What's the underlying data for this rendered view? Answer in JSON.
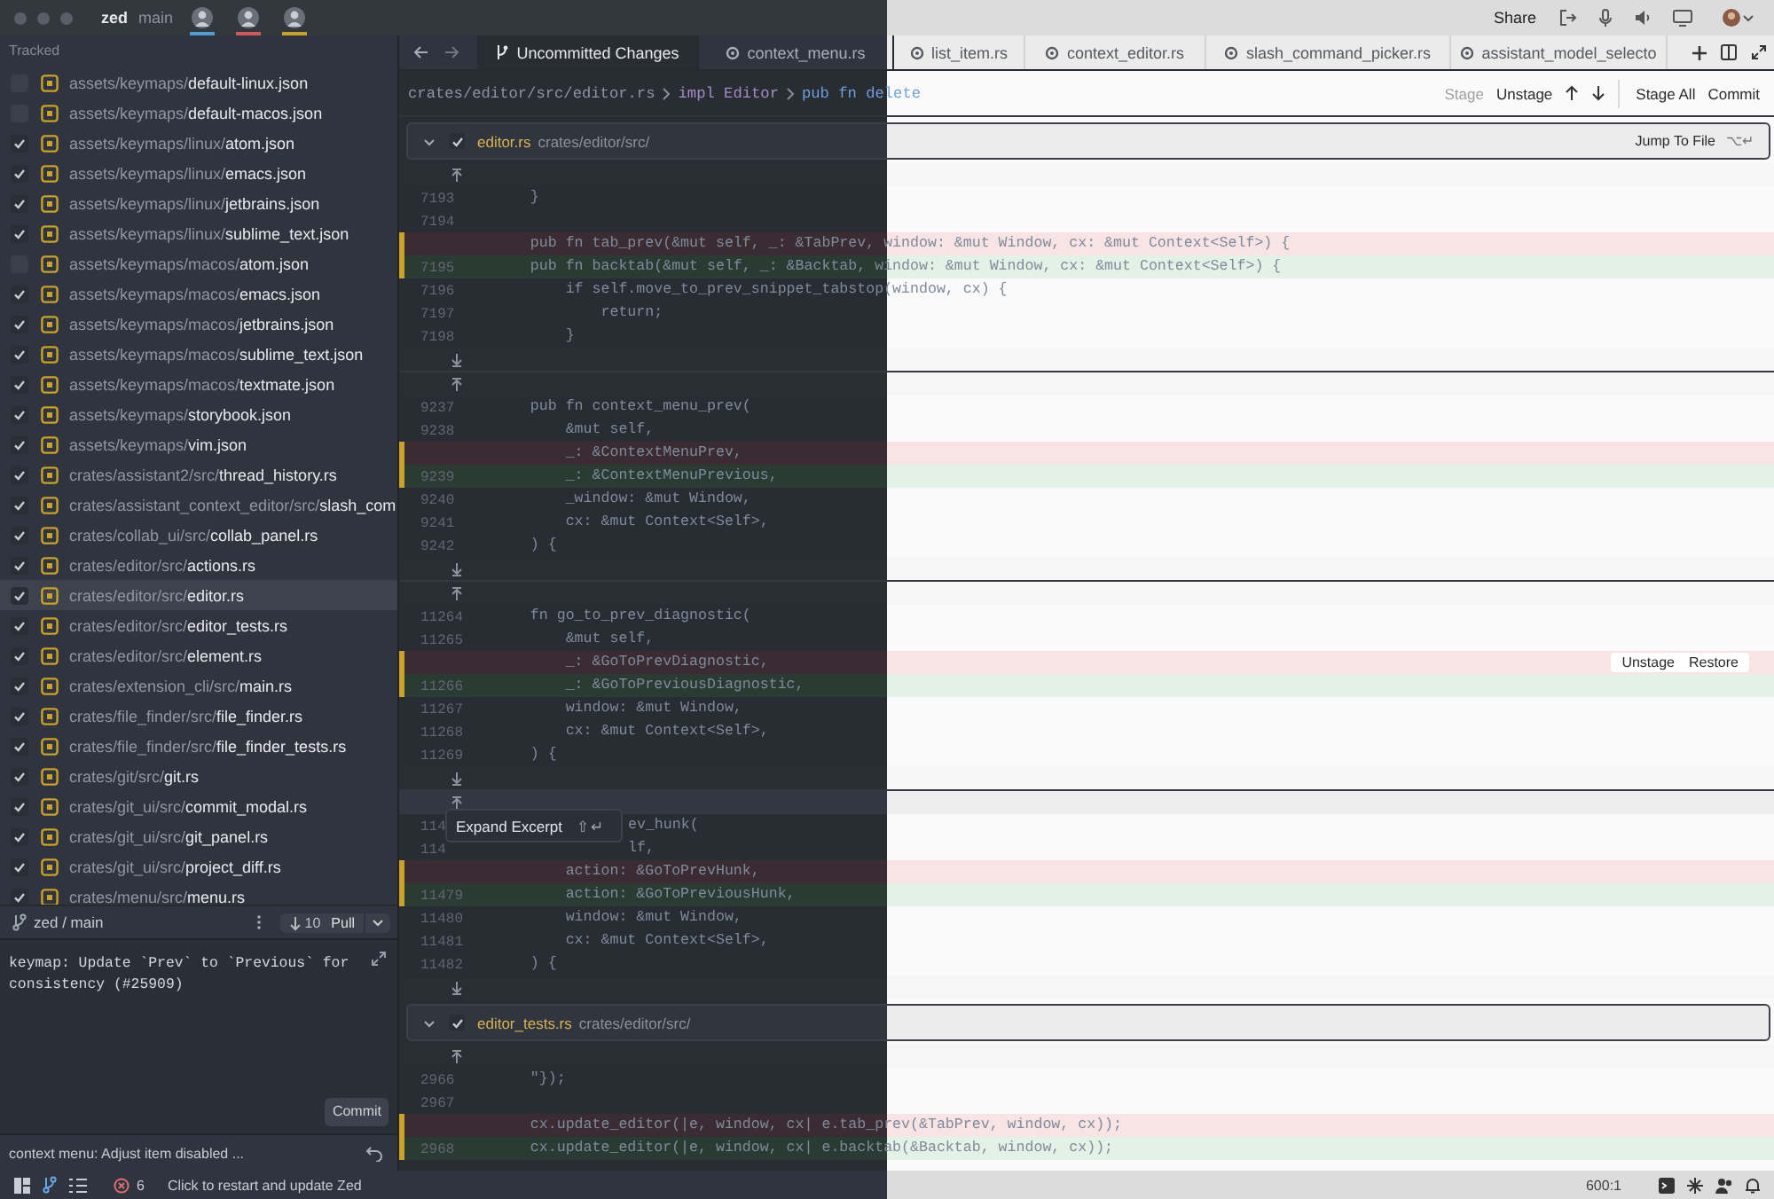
{
  "title_bar": {
    "project": "zed",
    "branch": "main",
    "collaborators": [
      {
        "color": "#4a9fd8"
      },
      {
        "color": "#d0575a"
      },
      {
        "color": "#c9a227"
      }
    ],
    "share": "Share"
  },
  "sidebar": {
    "section": "Tracked",
    "files": [
      {
        "prefix": "assets/keymaps/",
        "name": "default-linux.json",
        "checked": false,
        "selected": false
      },
      {
        "prefix": "assets/keymaps/",
        "name": "default-macos.json",
        "checked": false,
        "selected": false
      },
      {
        "prefix": "assets/keymaps/linux/",
        "name": "atom.json",
        "checked": true,
        "selected": false
      },
      {
        "prefix": "assets/keymaps/linux/",
        "name": "emacs.json",
        "checked": true,
        "selected": false
      },
      {
        "prefix": "assets/keymaps/linux/",
        "name": "jetbrains.json",
        "checked": true,
        "selected": false
      },
      {
        "prefix": "assets/keymaps/linux/",
        "name": "sublime_text.json",
        "checked": true,
        "selected": false
      },
      {
        "prefix": "assets/keymaps/macos/",
        "name": "atom.json",
        "checked": false,
        "selected": false
      },
      {
        "prefix": "assets/keymaps/macos/",
        "name": "emacs.json",
        "checked": true,
        "selected": false
      },
      {
        "prefix": "assets/keymaps/macos/",
        "name": "jetbrains.json",
        "checked": true,
        "selected": false
      },
      {
        "prefix": "assets/keymaps/macos/",
        "name": "sublime_text.json",
        "checked": true,
        "selected": false
      },
      {
        "prefix": "assets/keymaps/macos/",
        "name": "textmate.json",
        "checked": true,
        "selected": false
      },
      {
        "prefix": "assets/keymaps/",
        "name": "storybook.json",
        "checked": true,
        "selected": false
      },
      {
        "prefix": "assets/keymaps/",
        "name": "vim.json",
        "checked": true,
        "selected": false
      },
      {
        "prefix": "crates/assistant2/src/",
        "name": "thread_history.rs",
        "checked": true,
        "selected": false
      },
      {
        "prefix": "crates/assistant_context_editor/src/",
        "name": "slash_com",
        "checked": true,
        "selected": false
      },
      {
        "prefix": "crates/collab_ui/src/",
        "name": "collab_panel.rs",
        "checked": true,
        "selected": false
      },
      {
        "prefix": "crates/editor/src/",
        "name": "actions.rs",
        "checked": true,
        "selected": false
      },
      {
        "prefix": "crates/editor/src/",
        "name": "editor.rs",
        "checked": true,
        "selected": true
      },
      {
        "prefix": "crates/editor/src/",
        "name": "editor_tests.rs",
        "checked": true,
        "selected": false
      },
      {
        "prefix": "crates/editor/src/",
        "name": "element.rs",
        "checked": true,
        "selected": false
      },
      {
        "prefix": "crates/extension_cli/src/",
        "name": "main.rs",
        "checked": true,
        "selected": false
      },
      {
        "prefix": "crates/file_finder/src/",
        "name": "file_finder.rs",
        "checked": true,
        "selected": false
      },
      {
        "prefix": "crates/file_finder/src/",
        "name": "file_finder_tests.rs",
        "checked": true,
        "selected": false
      },
      {
        "prefix": "crates/git/src/",
        "name": "git.rs",
        "checked": true,
        "selected": false
      },
      {
        "prefix": "crates/git_ui/src/",
        "name": "commit_modal.rs",
        "checked": true,
        "selected": false
      },
      {
        "prefix": "crates/git_ui/src/",
        "name": "git_panel.rs",
        "checked": true,
        "selected": false
      },
      {
        "prefix": "crates/git_ui/src/",
        "name": "project_diff.rs",
        "checked": true,
        "selected": false
      },
      {
        "prefix": "crates/menu/src/",
        "name": "menu.rs",
        "checked": true,
        "selected": false
      }
    ],
    "branch": "zed / main",
    "pull": {
      "count": "10",
      "label": "Pull"
    },
    "commit_message": "keymap: Update `Prev` to `Previous` for consistency (#25909)",
    "commit_button": "Commit",
    "last_commit": "context menu: Adjust item disabled ..."
  },
  "tabs": [
    {
      "label": "Uncommitted Changes",
      "kind": "diff",
      "selected": true
    },
    {
      "label": "context_menu.rs",
      "kind": "file",
      "selected": false
    },
    {
      "label": "list_item.rs",
      "kind": "file",
      "selected": false
    },
    {
      "label": "context_editor.rs",
      "kind": "file",
      "selected": false
    },
    {
      "label": "slash_command_picker.rs",
      "kind": "file",
      "selected": false
    },
    {
      "label": "assistant_model_selecto",
      "kind": "file",
      "selected": false
    }
  ],
  "breadcrumb": [
    "crates/editor/src/editor.rs",
    "impl Editor",
    "pub fn delete"
  ],
  "toolbar": {
    "left": [
      {
        "label": "Stage",
        "disabled": true
      },
      {
        "label": "Unstage",
        "disabled": false
      }
    ],
    "right": [
      {
        "label": "Stage All",
        "disabled": false
      },
      {
        "label": "Commit",
        "disabled": false
      }
    ]
  },
  "excerpts": [
    {
      "file": "editor.rs",
      "path": "crates/editor/src/",
      "checked": true,
      "jump": {
        "label": "Jump To File",
        "shortcut": "⌥↵"
      },
      "groups": [
        {
          "lines": [
            {
              "kind": "expand_up"
            },
            {
              "kind": "context",
              "number": "7193",
              "text": "    }"
            },
            {
              "kind": "context",
              "number": "7194"
            },
            {
              "kind": "deleted",
              "text": "    pub fn tab_prev(&mut self, _: &TabPrev, window: &mut Window, cx: &mut Context<Self>) {"
            },
            {
              "kind": "added",
              "number": "7195",
              "text": "    pub fn backtab(&mut self, _: &Backtab, window: &mut Window, cx: &mut Context<Self>) {"
            },
            {
              "kind": "context",
              "number": "7196",
              "text": "        if self.move_to_prev_snippet_tabstop(window, cx) {"
            },
            {
              "kind": "context",
              "number": "7197",
              "text": "            return;"
            },
            {
              "kind": "context",
              "number": "7198",
              "text": "        }"
            },
            {
              "kind": "expand_down"
            }
          ]
        },
        {
          "lines": [
            {
              "kind": "expand_up"
            },
            {
              "kind": "context",
              "number": "9237",
              "text": "    pub fn context_menu_prev("
            },
            {
              "kind": "context",
              "number": "9238",
              "text": "        &mut self,"
            },
            {
              "kind": "deleted",
              "text": "        _: &ContextMenuPrev,"
            },
            {
              "kind": "added",
              "number": "9239",
              "text": "        _: &ContextMenuPrevious,"
            },
            {
              "kind": "context",
              "number": "9240",
              "text": "        _window: &mut Window,"
            },
            {
              "kind": "context",
              "number": "9241",
              "text": "        cx: &mut Context<Self>,"
            },
            {
              "kind": "context",
              "number": "9242",
              "text": "    ) {"
            },
            {
              "kind": "expand_down"
            }
          ]
        },
        {
          "lines": [
            {
              "kind": "expand_up"
            },
            {
              "kind": "context",
              "number": "11264",
              "text": "    fn go_to_prev_diagnostic("
            },
            {
              "kind": "context",
              "number": "11265",
              "text": "        &mut self,"
            },
            {
              "kind": "deleted",
              "text": "        _: &GoToPrevDiagnostic,",
              "actions": [
                "Unstage",
                "Restore"
              ]
            },
            {
              "kind": "added",
              "number": "11266",
              "text": "        _: &GoToPreviousDiagnostic,"
            },
            {
              "kind": "context",
              "number": "11267",
              "text": "        window: &mut Window,"
            },
            {
              "kind": "context",
              "number": "11268",
              "text": "        cx: &mut Context<Self>,"
            },
            {
              "kind": "context",
              "number": "11269",
              "text": "    ) {"
            },
            {
              "kind": "expand_down"
            }
          ]
        },
        {
          "lines": [
            {
              "kind": "expand_up",
              "tooltip": {
                "label": "Expand Excerpt",
                "shortcut": "⇧↵"
              }
            },
            {
              "kind": "context",
              "number": "114",
              "text": "ev_hunk("
            },
            {
              "kind": "context",
              "number": "114",
              "text": "lf,"
            },
            {
              "kind": "deleted",
              "text": "        action: &GoToPrevHunk,"
            },
            {
              "kind": "added",
              "number": "11479",
              "text": "        action: &GoToPreviousHunk,"
            },
            {
              "kind": "context",
              "number": "11480",
              "text": "        window: &mut Window,"
            },
            {
              "kind": "context",
              "number": "11481",
              "text": "        cx: &mut Context<Self>,"
            },
            {
              "kind": "context",
              "number": "11482",
              "text": "    ) {"
            },
            {
              "kind": "expand_down"
            }
          ]
        }
      ]
    },
    {
      "file": "editor_tests.rs",
      "path": "crates/editor/src/",
      "checked": true,
      "groups": [
        {
          "lines": [
            {
              "kind": "expand_up"
            },
            {
              "kind": "context",
              "number": "2966",
              "text": "    \"});"
            },
            {
              "kind": "context",
              "number": "2967"
            },
            {
              "kind": "deleted",
              "text": "    cx.update_editor(|e, window, cx| e.tab_prev(&TabPrev, window, cx));"
            },
            {
              "kind": "added",
              "number": "2968",
              "text": "    cx.update_editor(|e, window, cx| e.backtab(&Backtab, window, cx));"
            }
          ]
        }
      ]
    }
  ],
  "status_bar": {
    "errors": "6",
    "message": "Click to restart and update Zed",
    "position": "600:1"
  }
}
